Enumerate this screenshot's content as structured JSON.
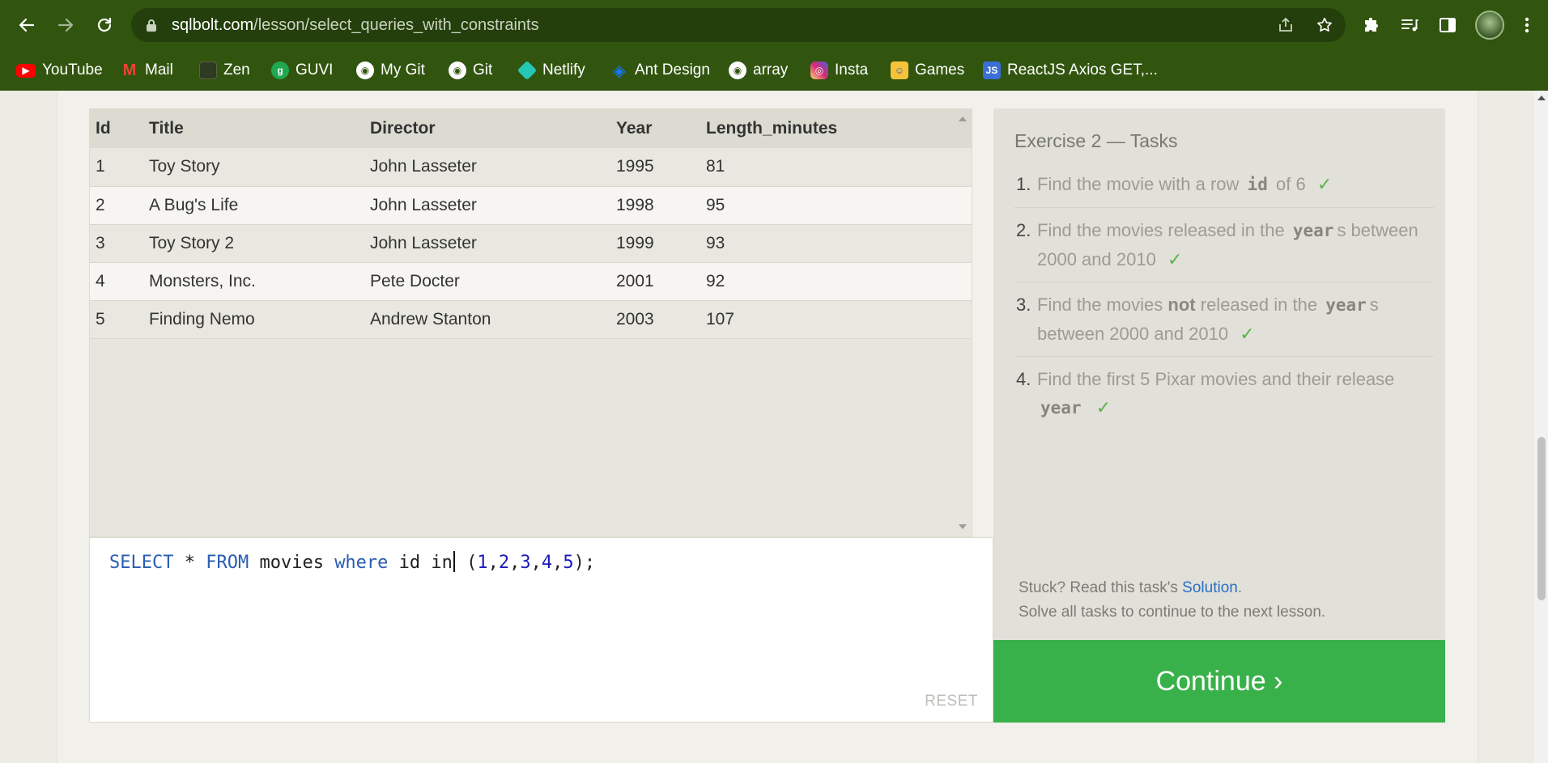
{
  "browser": {
    "url_host": "sqlbolt.com",
    "url_path": "/lesson/select_queries_with_constraints",
    "bookmarks": [
      {
        "label": "YouTube",
        "icon": "youtube-icon",
        "color": "#ff0000"
      },
      {
        "label": "Mail",
        "icon": "gmail-icon",
        "color": "#ea4335"
      },
      {
        "label": "Zen",
        "icon": "zen-icon",
        "color": "#3c4a2c"
      },
      {
        "label": "GUVI",
        "icon": "guvi-icon",
        "color": "#1fa84f"
      },
      {
        "label": "My Git",
        "icon": "github-icon",
        "color": "#ffffff"
      },
      {
        "label": "Git",
        "icon": "github-icon",
        "color": "#ffffff"
      },
      {
        "label": "Netlify",
        "icon": "netlify-icon",
        "color": "#25c7b7"
      },
      {
        "label": "Ant Design",
        "icon": "antdesign-icon",
        "color": "#1677ff"
      },
      {
        "label": "array",
        "icon": "github-icon",
        "color": "#ffffff"
      },
      {
        "label": "Insta",
        "icon": "instagram-icon",
        "color": "#d62976"
      },
      {
        "label": "Games",
        "icon": "games-icon",
        "color": "#f6c338"
      },
      {
        "label": "ReactJS Axios GET,...",
        "icon": "js-icon",
        "color": "#3a6fd8"
      }
    ]
  },
  "results": {
    "columns": [
      "Id",
      "Title",
      "Director",
      "Year",
      "Length_minutes"
    ],
    "rows": [
      [
        "1",
        "Toy Story",
        "John Lasseter",
        "1995",
        "81"
      ],
      [
        "2",
        "A Bug's Life",
        "John Lasseter",
        "1998",
        "95"
      ],
      [
        "3",
        "Toy Story 2",
        "John Lasseter",
        "1999",
        "93"
      ],
      [
        "4",
        "Monsters, Inc.",
        "Pete Docter",
        "2001",
        "92"
      ],
      [
        "5",
        "Finding Nemo",
        "Andrew Stanton",
        "2003",
        "107"
      ]
    ]
  },
  "editor": {
    "query_parts": {
      "select": "SELECT",
      "star": " * ",
      "from": "FROM",
      "table": " movies ",
      "where": "where",
      "col": " id in",
      "open": " (",
      "n1": "1",
      "n2": "2",
      "n3": "3",
      "n4": "4",
      "n5": "5",
      "comma": ",",
      "close": ");"
    },
    "reset_label": "RESET"
  },
  "tasks": {
    "title": "Exercise 2 — Tasks",
    "items": [
      {
        "num": "1.",
        "pre": "Find the movie with a row",
        "code": "id",
        "post": "of 6",
        "check": "✓"
      },
      {
        "num": "2.",
        "pre": "Find the movies released in the",
        "code": "year",
        "post": "s between 2000 and 2010",
        "check": "✓"
      },
      {
        "num": "3.",
        "pre": "Find the movies",
        "bold": "not",
        "mid": "released in the",
        "code": "year",
        "post": "s between 2000 and 2010",
        "check": "✓"
      },
      {
        "num": "4.",
        "pre": "Find the first 5 Pixar movies and their release",
        "code": "year",
        "post": "",
        "check": "✓"
      }
    ],
    "stuck_pre": "Stuck? Read this task's",
    "solution_link": "Solution",
    "stuck_post": ".",
    "stuck_line2": "Solve all tasks to continue to the next lesson.",
    "continue_label": "Continue ›"
  }
}
